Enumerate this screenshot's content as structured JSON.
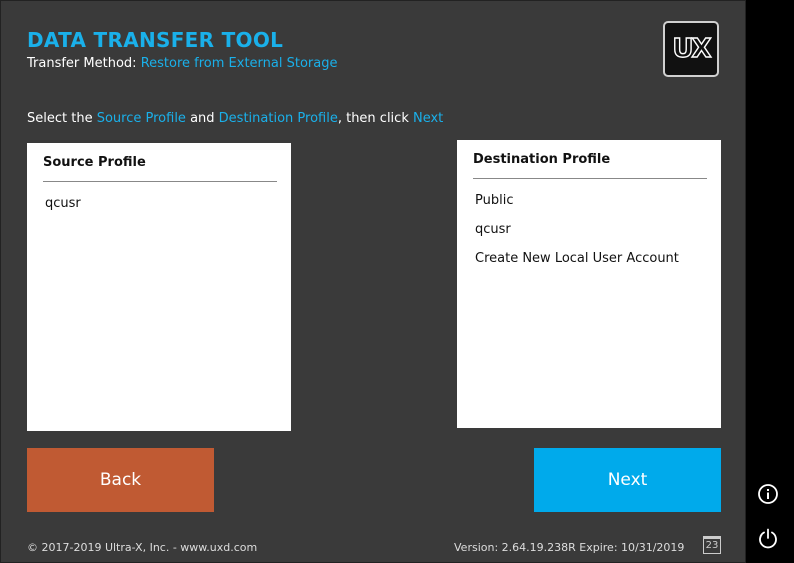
{
  "app": {
    "title": "DATA TRANSFER TOOL",
    "method_prefix": "Transfer Method: ",
    "method_value": "Restore from External Storage",
    "logo_text": "UX"
  },
  "instruction": {
    "part1": "Select the ",
    "source_link": "Source Profile",
    "part2": " and ",
    "dest_link": "Destination Profile",
    "part3": ", then click ",
    "next_link": "Next"
  },
  "source_panel": {
    "title": "Source Profile",
    "items": [
      "qcusr"
    ]
  },
  "dest_panel": {
    "title": "Destination Profile",
    "items": [
      "Public",
      "qcusr",
      "Create New Local User Account"
    ]
  },
  "buttons": {
    "back": "Back",
    "next": "Next"
  },
  "footer": {
    "copyright": "© 2017-2019 Ultra-X, Inc. - www.uxd.com",
    "version": "Version: 2.64.19.238R Expire: 10/31/2019",
    "calendar_day": "23"
  },
  "icons": {
    "info": "info-icon",
    "power": "power-icon",
    "calendar": "calendar-icon"
  },
  "colors": {
    "accent": "#1ab0ea",
    "background": "#3a3a3a",
    "back_button": "#c05a33",
    "next_button": "#00aaeb"
  }
}
